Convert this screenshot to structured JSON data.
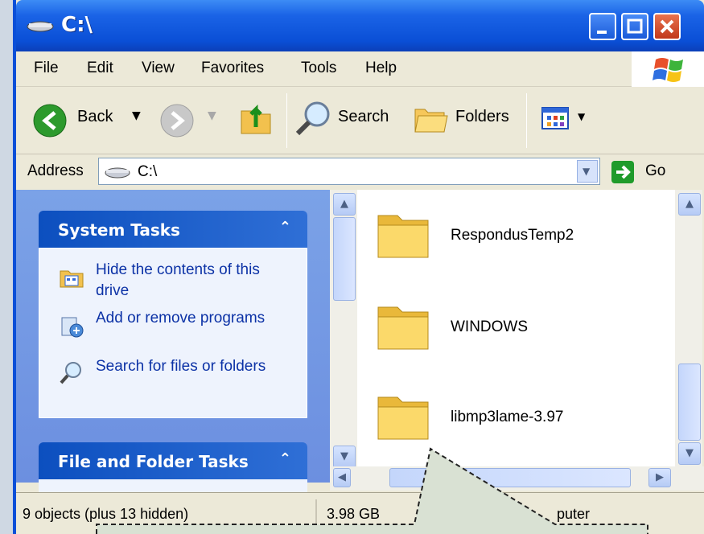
{
  "window": {
    "title": "C:\\"
  },
  "menubar": {
    "items": [
      "File",
      "Edit",
      "View",
      "Favorites",
      "Tools",
      "Help"
    ]
  },
  "toolbar": {
    "back_label": "Back",
    "search_label": "Search",
    "folders_label": "Folders"
  },
  "address": {
    "label": "Address",
    "value": "C:\\",
    "go_label": "Go"
  },
  "left_pane": {
    "system_tasks": {
      "title": "System Tasks",
      "items": [
        "Hide the contents of this drive",
        "Add or remove programs",
        "Search for files or folders"
      ]
    },
    "file_folder_tasks": {
      "title": "File and Folder Tasks"
    }
  },
  "files": [
    {
      "name": "RespondusTemp2"
    },
    {
      "name": "WINDOWS"
    },
    {
      "name": "libmp3lame-3.97"
    }
  ],
  "statusbar": {
    "objects": "9 objects (plus 13 hidden)",
    "size": "3.98 GB",
    "location": "puter"
  },
  "colors": {
    "titlebar": "#0a4fd6",
    "task_panel_bg": "#eef3fd",
    "task_link": "#0c32a6",
    "callout_fill": "#d9e1d3"
  }
}
